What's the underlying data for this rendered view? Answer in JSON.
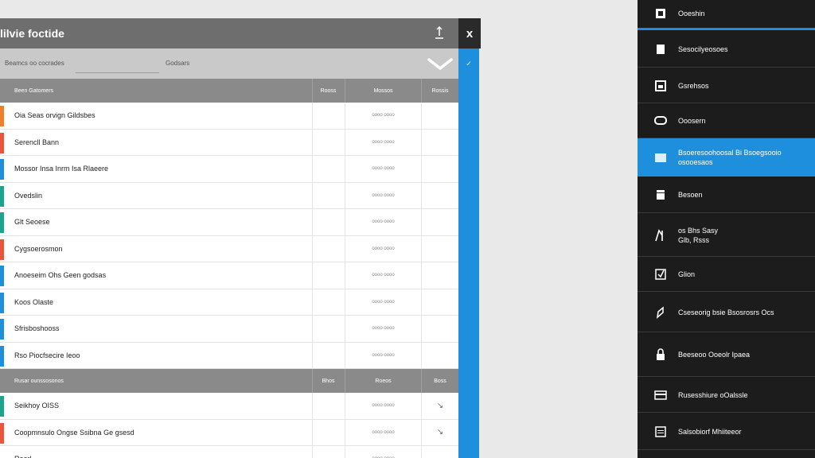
{
  "window": {
    "title": "lilvie foctide",
    "close_label": "x",
    "accent_check": "✓"
  },
  "filters": {
    "field_one": "Beamcs oo cocrades",
    "field_two": "Godsars"
  },
  "colors": {
    "accent": "#1e8fdc",
    "header_bg": "#6e6e6e",
    "sidebar_bg": "#1c1c1c",
    "tag_orange": "#f07f2a",
    "tag_red": "#e8553a",
    "tag_blue": "#1e8fdc",
    "tag_teal": "#1aa58c"
  },
  "table": {
    "group_one": {
      "headers": [
        "Been Gatomers",
        "Rooss",
        "Mossos",
        "Rossis"
      ],
      "rows": [
        {
          "name": "Oia Seas orvign Gildsbes",
          "col3": "oooo oooo",
          "col4": "",
          "tag": "orange"
        },
        {
          "name": "Serencll Bann",
          "col3": "oooo oooo",
          "col4": "",
          "tag": "red"
        },
        {
          "name": "Mossor Insa Inrm Isa Rlaeere",
          "col3": "oooo oooo",
          "col4": "",
          "tag": "blue"
        },
        {
          "name": "Ovedslin",
          "col3": "oooo oooo",
          "col4": "",
          "tag": "teal"
        },
        {
          "name": "Glt Seoese",
          "col3": "oooo oooo",
          "col4": "",
          "tag": "teal"
        },
        {
          "name": "Cygsoerosmon",
          "col3": "oooo oooo",
          "col4": "",
          "tag": "red"
        },
        {
          "name": "Anoeseim Ohs Geen godsas",
          "col3": "oooo oooo",
          "col4": "",
          "tag": "blue"
        },
        {
          "name": "Koos Olaste",
          "col3": "oooo oooo",
          "col4": "",
          "tag": "blue"
        },
        {
          "name": "Sfrisboshooss",
          "col3": "oooo oooo",
          "col4": "",
          "tag": "blue"
        },
        {
          "name": "Rso Piocfsecire Ieoo",
          "col3": "oooo oooo",
          "col4": "",
          "tag": "blue"
        }
      ]
    },
    "group_two": {
      "headers": [
        "Rusar ounssosonos",
        "Bhos",
        "Roeos",
        "Boss"
      ],
      "rows": [
        {
          "name": "Seikhoy OISS",
          "col3": "oooo oooo",
          "col4": "↘",
          "tag": "teal"
        },
        {
          "name": "Coopmnsulo Ongse Ssibna Ge gsesd",
          "col3": "oooo oooo",
          "col4": "↘",
          "tag": "red"
        },
        {
          "name": "Reorl",
          "col3": "oooo oooo",
          "col4": "",
          "tag": "none"
        }
      ]
    }
  },
  "sidebar": {
    "items": [
      {
        "label": "Ooeshin",
        "icon": "user-icon"
      },
      {
        "label": "Sesocilyeosoes",
        "icon": "document-icon"
      },
      {
        "label": "Gsrehsos",
        "icon": "image-icon"
      },
      {
        "label": "Ooosern",
        "icon": "chat-icon"
      },
      {
        "label": "Bsoeresoohoosal Bi Bsoegsooio\nosooesaos",
        "icon": "folder-icon"
      },
      {
        "label": "Besoen",
        "icon": "box-icon"
      },
      {
        "label": "os Bhs Sasy\nGlb, Rsss",
        "icon": "chart-icon"
      },
      {
        "label": "Glion",
        "icon": "checkbox-icon"
      },
      {
        "label": "Cseseorig bsie Bsosrosrs Ocs",
        "icon": "pen-icon"
      },
      {
        "label": "Beeseoo Ooeolr Ipaea",
        "icon": "lock-icon"
      },
      {
        "label": "Rusesshiure oOalssle",
        "icon": "card-icon"
      },
      {
        "label": "Salsobiorf Mhiiteeor",
        "icon": "window-icon"
      }
    ]
  }
}
